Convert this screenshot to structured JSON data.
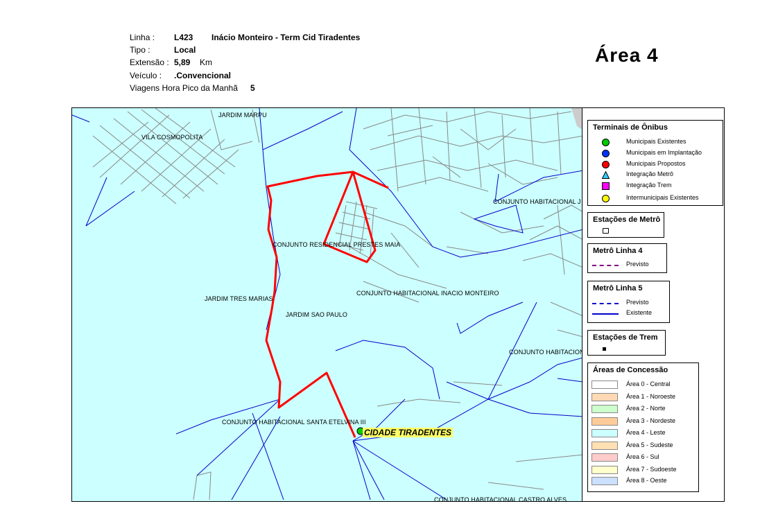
{
  "header": {
    "linha_label": "Linha :",
    "linha_code": "L423",
    "linha_name": "Inácio Monteiro - Term Cid Tiradentes",
    "tipo_label": "Tipo :",
    "tipo_value": "Local",
    "extensao_label": "Extensão :",
    "extensao_value": "5,89",
    "extensao_unit": "Km",
    "veiculo_label": "Veículo :",
    "veiculo_value": ".Convencional",
    "viagens_label": "Viagens Hora Pico da Manhã",
    "viagens_value": "5"
  },
  "area_title": "Área  4",
  "map": {
    "background_color": "#ccffff",
    "route_color": "#ff0000",
    "metro_line_color": "#0000cc",
    "place_labels": {
      "jardim_marpu": "JARDIM MARPU",
      "vila_cosmopolita": "VILA COSMOPOLITA",
      "conj_habitacional_j": "CONJUNTO HABITACIONAL J",
      "conj_prestes_maia": "CONJUNTO RESIDENCIAL PRESTES MAIA",
      "jardim_tres_marias": "JARDIM TRES MARIAS",
      "conj_inacio_monteiro": "CONJUNTO HABITACIONAL INACIO MONTEIRO",
      "jardim_sao_paulo": "JARDIM SAO PAULO",
      "conj_habitacion": "CONJUNTO HABITACION",
      "conj_santa_etelvina": "CONJUNTO HABITACIONAL SANTA ETELVINA III",
      "conj_castro_alves": "CONJUNTO HABITACIONAL CASTRO ALVES"
    },
    "terminal_label": "CIDADE TIRADENTES"
  },
  "legend": {
    "terminais": {
      "title": "Terminais de Ônibus",
      "items": [
        {
          "label": "Municipais Existentes",
          "color": "#00cc00",
          "shape": "circle"
        },
        {
          "label": "Municipais em Implantação",
          "color": "#0033ff",
          "shape": "circle"
        },
        {
          "label": "Municipais Propostos",
          "color": "#ff0000",
          "shape": "circle"
        },
        {
          "label": "Integração Metrô",
          "color": "#33ccff",
          "shape": "triangle"
        },
        {
          "label": "Integração Trem",
          "color": "#ff00ff",
          "shape": "square"
        },
        {
          "label": "Intermunicipais Existentes",
          "color": "#ffff00",
          "shape": "circle"
        }
      ]
    },
    "estacoes_metro": {
      "title": "Estações de Metrô"
    },
    "metro_linha4": {
      "title": "Metrô Linha 4",
      "items": [
        {
          "label": "Previsto",
          "color": "#800080",
          "style": "dashed"
        }
      ]
    },
    "metro_linha5": {
      "title": "Metrô Linha 5",
      "items": [
        {
          "label": "Previsto",
          "color": "#0000cc",
          "style": "dashed"
        },
        {
          "label": "Existente",
          "color": "#0000cc",
          "style": "solid"
        }
      ]
    },
    "estacoes_trem": {
      "title": "Estações de Trem"
    },
    "areas": {
      "title": "Áreas de Concessão",
      "items": [
        {
          "label": "Área 0 - Central",
          "color": "#ffffff"
        },
        {
          "label": "Área 1 - Noroeste",
          "color": "#ffd9b3"
        },
        {
          "label": "Área 2 - Norte",
          "color": "#ccffcc"
        },
        {
          "label": "Área 3 - Nordeste",
          "color": "#ffcc99"
        },
        {
          "label": "Área 4 - Leste",
          "color": "#ccffff"
        },
        {
          "label": "Área 5 - Sudeste",
          "color": "#ffe0b3"
        },
        {
          "label": "Área 6 - Sul",
          "color": "#ffcccc"
        },
        {
          "label": "Área 7 - Sudoeste",
          "color": "#ffffcc"
        },
        {
          "label": "Área 8 - Oeste",
          "color": "#cce0ff"
        }
      ]
    }
  }
}
